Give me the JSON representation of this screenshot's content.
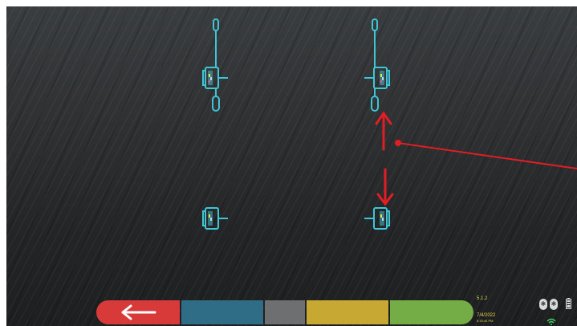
{
  "toolbar": {
    "back_label": "Back",
    "segments": [
      "back",
      "blue",
      "gray",
      "yellow",
      "green"
    ]
  },
  "status": {
    "version": "5.1.2",
    "date": "7/4/2022",
    "time": "5:33:44 PM"
  },
  "icons": {
    "back": "left-arrow-icon",
    "bluetooth": "bluetooth-icon",
    "battery": "battery-icon",
    "wifi": "wifi-icon"
  },
  "colors": {
    "sensor": "#3fc6d6",
    "annotation": "#e01e25",
    "back_button": "#d83a3a",
    "blue_button": "#2f6d87",
    "gray_button": "#6e6f70",
    "yellow_button": "#c7a833",
    "green_button": "#74ad45",
    "status_text": "#e6d84b"
  }
}
